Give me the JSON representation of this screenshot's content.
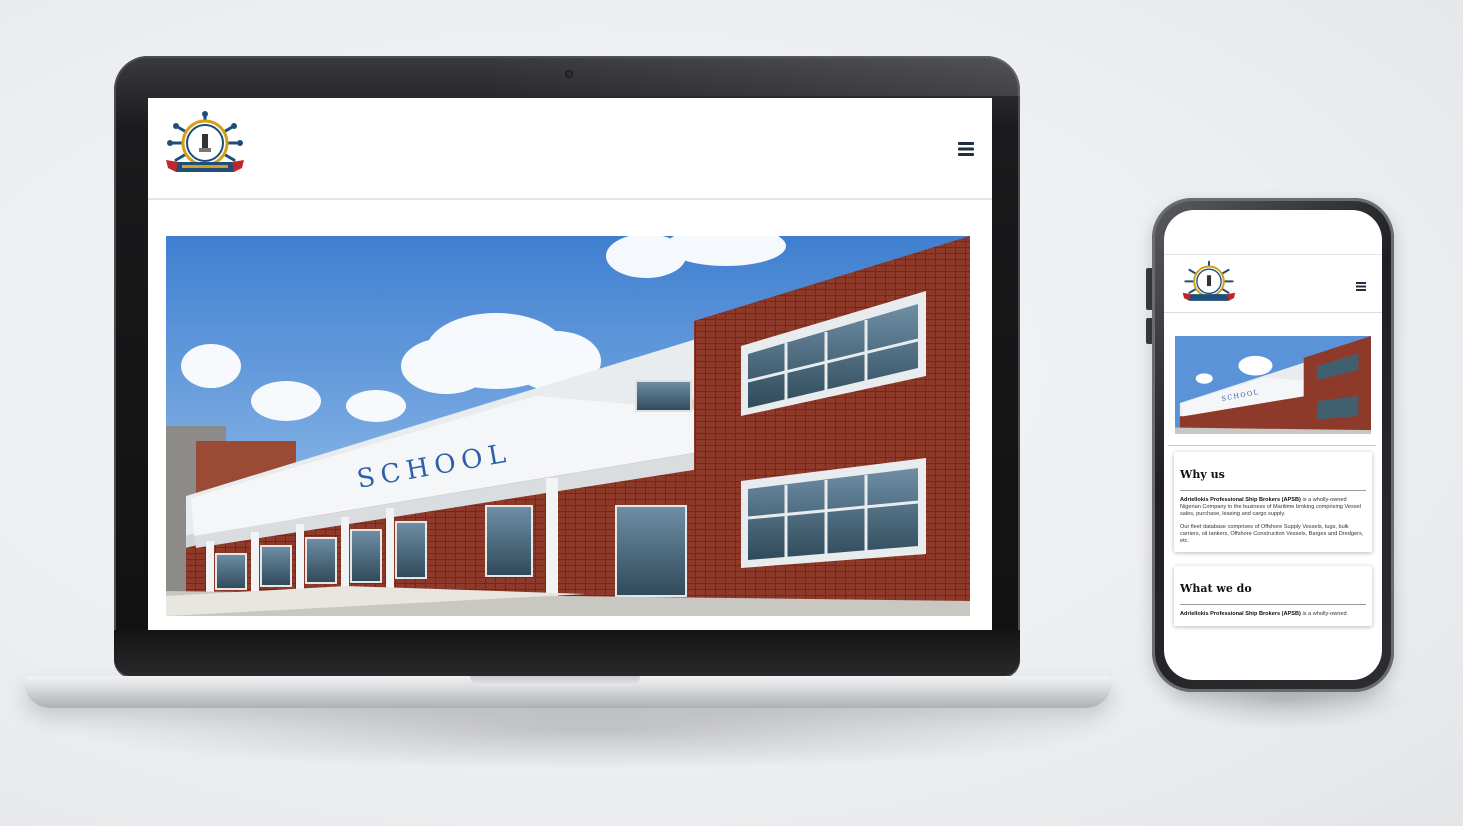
{
  "brand": {
    "logo_name": "ship-wheel-crest-logo"
  },
  "laptop_page": {
    "menu_icon": "hamburger-menu-icon",
    "hero_image": {
      "kind": "school-building-photo",
      "sign_text": "SCHOOL"
    }
  },
  "phone_page": {
    "menu_icon": "hamburger-menu-icon",
    "hero_image": {
      "kind": "school-building-photo",
      "sign_text": "SCHOOL"
    },
    "cards": [
      {
        "title": "Why us",
        "lead_bold": "Adriellokis Professional Ship Brokers (APSB)",
        "lead_rest": " is a wholly-owned Nigerian Company in the business of Maritime broking comprising Vessel sales, purchase, leasing and cargo supply.",
        "body": "Our fleet database comprises of Offshore Supply Vessels, tugs, bulk carriers, oil tankers, Offshore Construction Vessels, Barges and Dredgers, etc."
      },
      {
        "title": "What we do",
        "lead_bold": "Adriellokis Professional Ship Brokers (APSB)",
        "lead_rest": " is a wholly-owned"
      }
    ]
  },
  "colors": {
    "header_border": "#e6e6e6",
    "menu_icon": "#1f2d3d",
    "logo_blue": "#1f4e79",
    "logo_gold": "#d4a017",
    "logo_red": "#c0272d"
  }
}
